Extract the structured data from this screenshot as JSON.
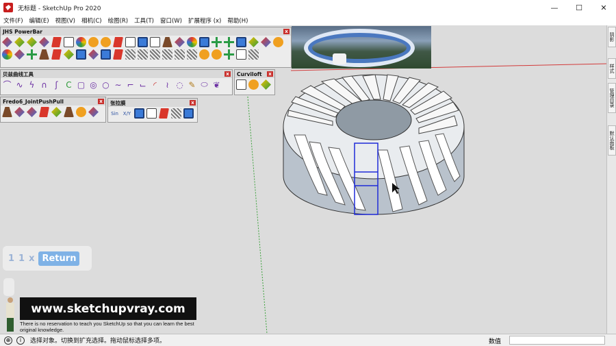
{
  "window": {
    "title": "无标题 - SketchUp Pro 2020"
  },
  "window_controls": [
    "—",
    "☐",
    "✕"
  ],
  "menu": [
    "文件(F)",
    "编辑(E)",
    "视图(V)",
    "相机(C)",
    "绘图(R)",
    "工具(T)",
    "窗口(W)",
    "扩展程序 (x)",
    "帮助(H)"
  ],
  "toolbars": {
    "jhs": {
      "title": "JHS PowerBar"
    },
    "bezier": {
      "title": "贝兹曲线工具"
    },
    "curviloft": {
      "title": "Curviloft"
    },
    "fredo": {
      "title": "Fredo6_JointPushPull"
    },
    "zhanglamo": {
      "title": "张拉膜",
      "labels": [
        "Sin",
        "X/Y"
      ]
    }
  },
  "hint": {
    "n1": "1",
    "n2": "1",
    "x": "x",
    "return_label": "Return"
  },
  "watermark": {
    "url": "www.sketchupvray.com",
    "caption": "There is no reservation to teach you SketchUp so that you can learn the best original knowledge."
  },
  "side_tabs": [
    "阴影",
    "样式",
    "管理目录",
    "默认面板"
  ],
  "status": {
    "message": "选择对象。切换到扩充选择。拖动鼠标选择多项。",
    "measure_label": "数值",
    "measure_value": ""
  },
  "colors": {
    "accent_red": "#c9302c",
    "axis_red": "#d23a3a",
    "axis_green": "#3aa13a",
    "selection_blue": "#1e2ad8"
  }
}
